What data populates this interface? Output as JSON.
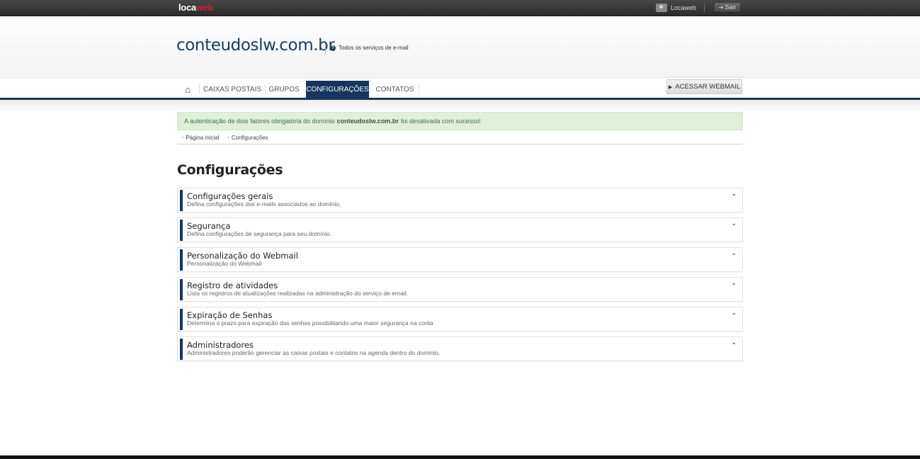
{
  "topbar": {
    "logo_part1": "loca",
    "logo_part2": "web",
    "user_name": "Locaweb",
    "logout_label": "Sair",
    "user_icon": "user-icon",
    "logout_icon": "logout-icon"
  },
  "header": {
    "domain": "conteudoslw.com.br",
    "all_services_label": "Todos os serviços de e-mail",
    "info_icon": "info-icon"
  },
  "nav": {
    "home_icon": "home-icon",
    "items": [
      {
        "label": "CAIXAS POSTAIS",
        "active": false
      },
      {
        "label": "GRUPOS",
        "active": false
      },
      {
        "label": "CONFIGURAÇÕES",
        "active": true
      },
      {
        "label": "CONTATOS",
        "active": false
      }
    ],
    "webmail_label": "ACESSAR WEBMAIL"
  },
  "alert": {
    "text_before": "A autenticação de dois fatores obrigatória do domínio",
    "domain": "conteudoslw.com.br",
    "text_after": "foi desativada com sucesso!"
  },
  "breadcrumb": {
    "items": [
      "Página inicial",
      "Configurações"
    ]
  },
  "page": {
    "title": "Configurações"
  },
  "sections": [
    {
      "title": "Configurações gerais",
      "description": "Defina configurações dos e-mails associados ao domínio."
    },
    {
      "title": "Segurança",
      "description": "Defina configurações de segurança para seu domínio."
    },
    {
      "title": "Personalização do Webmail",
      "description": "Personalização do Webmail"
    },
    {
      "title": "Registro de atividades",
      "description": "Lista os registros de atualizações realizadas na administração do serviço de email."
    },
    {
      "title": "Expiração de Senhas",
      "description": "Determina o prazo para expiração das senhas possibilitando uma maior segurança na conta"
    },
    {
      "title": "Administradores",
      "description": "Administradores poderão gerenciar as caixas postais e contatos na agenda dentro do domínio."
    }
  ],
  "colors": {
    "brand_navy": "#16355e",
    "logo_red": "#d21f3c",
    "alert_bg": "#dff0d8",
    "alert_text": "#3c763d"
  }
}
